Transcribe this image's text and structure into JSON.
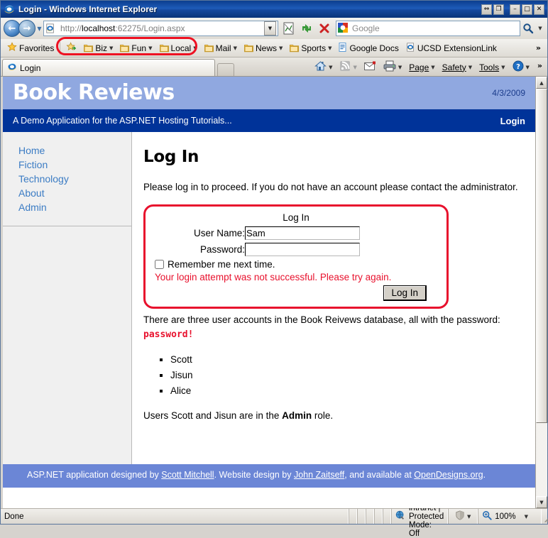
{
  "window": {
    "title": "Login - Windows Internet Explorer",
    "controls": {
      "restore_small": "⇔",
      "restore_down": "❐",
      "minimize": "–",
      "maximize": "□",
      "close": "✕"
    }
  },
  "toolbar": {
    "back": "←",
    "forward": "→",
    "history_dropdown": "▼",
    "url_value": "http://localhost:62275/Login.aspx",
    "url_scheme": "http://",
    "url_host": "localhost",
    "url_rest": ":62275/Login.aspx",
    "url_dropdown": "▼",
    "compat_view": "compatibility-view",
    "refresh": "refresh",
    "stop": "✕",
    "search_placeholder": "Google",
    "search_value": "",
    "search_go": "search-icon",
    "search_dropdown": "▼"
  },
  "favorites_bar": {
    "favorites_label": "Favorites",
    "add_to_favorites": "add-favorites-icon",
    "items": [
      {
        "label": "Biz",
        "icon": "folder-icon",
        "has_caret": true
      },
      {
        "label": "Fun",
        "icon": "folder-icon",
        "has_caret": true
      },
      {
        "label": "Local",
        "icon": "folder-icon",
        "has_caret": true
      },
      {
        "label": "Mail",
        "icon": "folder-icon",
        "has_caret": true
      },
      {
        "label": "News",
        "icon": "folder-icon",
        "has_caret": true
      },
      {
        "label": "Sports",
        "icon": "folder-icon",
        "has_caret": true
      },
      {
        "label": "Google Docs",
        "icon": "document-icon",
        "has_caret": false
      },
      {
        "label": "UCSD ExtensionLink",
        "icon": "ie-icon",
        "has_caret": false
      }
    ],
    "overflow": "»"
  },
  "tabs": {
    "items": [
      {
        "label": "Login",
        "icon": "ie-icon"
      }
    ],
    "new_tab": "new-tab-button"
  },
  "command_bar": {
    "home": "home-icon",
    "feeds": "feeds-icon",
    "read_mail": "mail-icon",
    "print": "print-icon",
    "page": "Page",
    "safety": "Safety",
    "tools": "Tools",
    "help": "?",
    "overflow": "»"
  },
  "page": {
    "header": {
      "site_title": "Book Reviews",
      "date": "4/3/2009",
      "tagline": "A Demo Application for the ASP.NET Hosting Tutorials...",
      "login_link": "Login",
      "band_light": "#90a8e0",
      "band_dark": "#003399"
    },
    "sidebar": {
      "items": [
        {
          "label": "Home"
        },
        {
          "label": "Fiction"
        },
        {
          "label": "Technology"
        },
        {
          "label": "About"
        },
        {
          "label": "Admin"
        }
      ]
    },
    "content": {
      "heading": "Log In",
      "intro": "Please log in to proceed. If you do not have an account please contact the administrator.",
      "login_panel": {
        "title": "Log In",
        "username_label": "User Name:",
        "username_value": "Sam",
        "password_label": "Password:",
        "password_value": "",
        "remember_label": "Remember me next time.",
        "remember_checked": false,
        "error_message": "Your login attempt was not successful. Please try again.",
        "submit_label": "Log In",
        "highlight_color": "#e8112d"
      },
      "accounts_text_before": "There are three user accounts in the Book Reivews database, all with the password: ",
      "accounts_password": "password!",
      "accounts": [
        "Scott",
        "Jisun",
        "Alice"
      ],
      "roles_before": "Users Scott and Jisun are in the ",
      "roles_bold": "Admin",
      "roles_after": " role."
    },
    "footer": {
      "text_1": "ASP.NET application designed by ",
      "link_1": "Scott Mitchell",
      "text_2": ". Website design by ",
      "link_2": "John Zaitseff",
      "text_3": ", and available at ",
      "link_3": "OpenDesigns.org",
      "text_4": ".",
      "background": "#6b86d6"
    }
  },
  "scrollbar": {
    "up_arrow": "▲",
    "down_arrow": "▼"
  },
  "statusbar": {
    "status": "Done",
    "zone": "Local intranet | Protected Mode: Off",
    "zone_icon": "globe-icon",
    "protected_icon": "shield-icon",
    "protected_caret": "▼",
    "zoom_icon": "zoom-icon",
    "zoom_level": "100%",
    "zoom_caret": "▼"
  }
}
